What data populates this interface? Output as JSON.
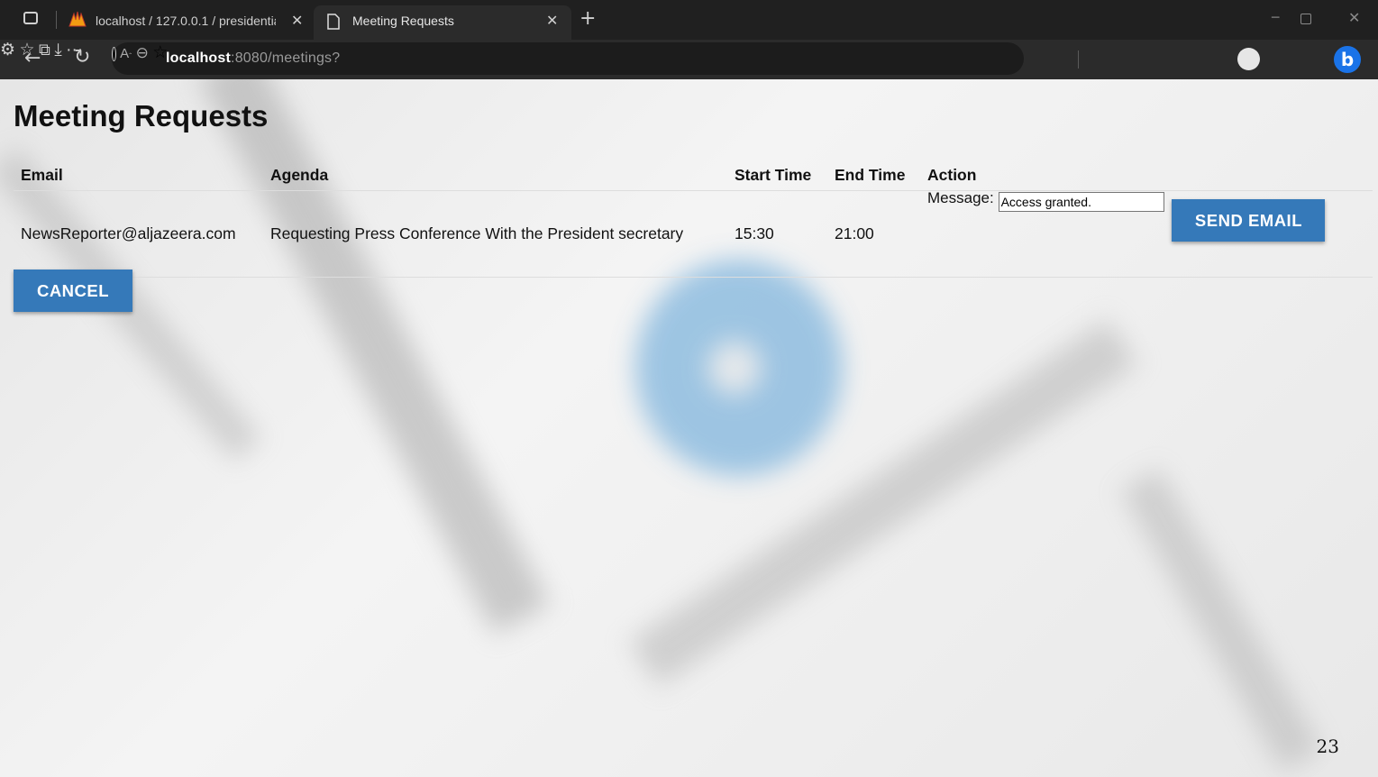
{
  "browser": {
    "tabs": [
      {
        "label": "localhost / 127.0.0.1 / presidentia",
        "icon": "phpmyadmin-icon"
      },
      {
        "label": "Meeting Requests",
        "icon": "page-icon"
      }
    ],
    "url_host": "localhost",
    "url_path": ":8080/meetings?"
  },
  "page": {
    "title": "Meeting Requests",
    "columns": [
      "Email",
      "Agenda",
      "Start Time",
      "End Time",
      "Action"
    ],
    "rows": [
      {
        "email": "NewsReporter@aljazeera.com",
        "agenda": "Requesting Press Conference With the President secretary",
        "start_time": "15:30",
        "end_time": "21:00",
        "message_label": "Message:",
        "message_value": "Access granted.",
        "send_label": "SEND EMAIL"
      }
    ],
    "cancel_label": "CANCEL",
    "page_number": "23"
  },
  "colors": {
    "button": "#3579b9",
    "chrome_dark": "#202020",
    "toolbar": "#2b2b2b"
  }
}
